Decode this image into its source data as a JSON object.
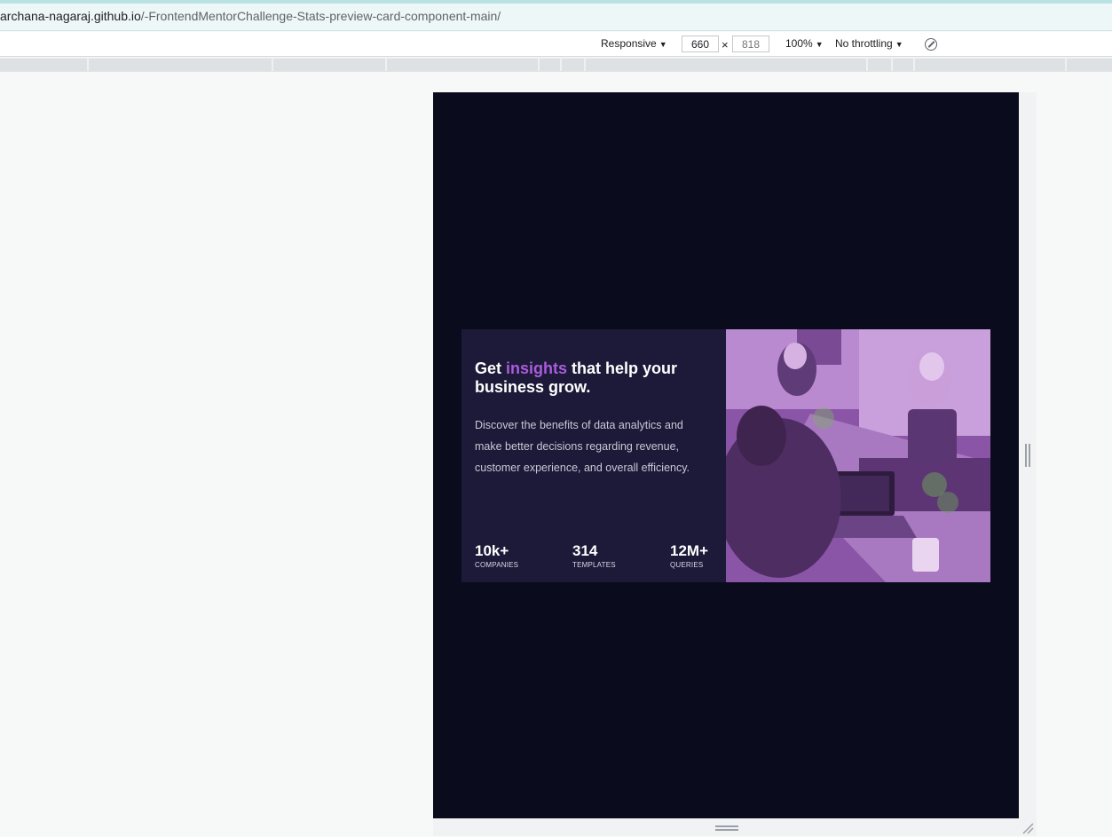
{
  "browser": {
    "url_host": "archana-nagaraj.github.io",
    "url_path": "/-FrontendMentorChallenge-Stats-preview-card-component-main/"
  },
  "device_toolbar": {
    "device": "Responsive",
    "width_value": "660",
    "times": "×",
    "height_placeholder": "818",
    "zoom": "100%",
    "throttling": "No throttling",
    "rotate_icon": "rotate-icon"
  },
  "card": {
    "heading_pre": "Get ",
    "heading_accent": "insights",
    "heading_post": " that help your business grow.",
    "description": "Discover the benefits of data analytics and make better decisions regarding revenue, customer experience, and overall efficiency.",
    "accent_color": "#aa5cdb",
    "stats": [
      {
        "value": "10k+",
        "label": "COMPANIES"
      },
      {
        "value": "314",
        "label": "TEMPLATES"
      },
      {
        "value": "12M+",
        "label": "QUERIES"
      }
    ]
  }
}
